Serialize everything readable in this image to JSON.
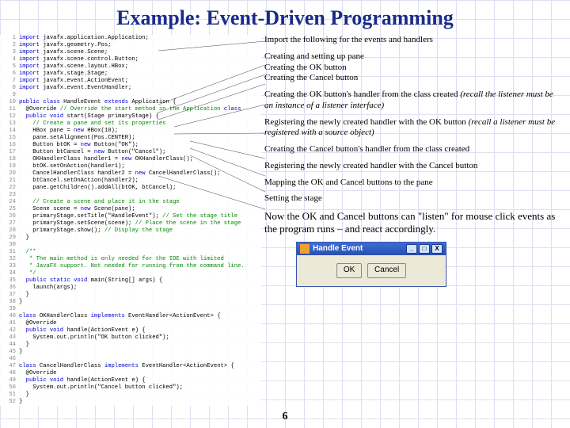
{
  "title": "Example: Event-Driven Programming",
  "code": [
    "import javafx.application.Application;",
    "import javafx.geometry.Pos;",
    "import javafx.scene.Scene;",
    "import javafx.scene.control.Button;",
    "import javafx.scene.layout.HBox;",
    "import javafx.stage.Stage;",
    "import javafx.event.ActionEvent;",
    "import javafx.event.EventHandler;",
    "",
    "public class HandleEvent extends Application {",
    "  @Override // Override the start method in the Application class",
    "  public void start(Stage primaryStage) {",
    "    // Create a pane and set its properties",
    "    HBox pane = new HBox(10);",
    "    pane.setAlignment(Pos.CENTER);",
    "    Button btOK = new Button(\"OK\");",
    "    Button btCancel = new Button(\"Cancel\");",
    "    OKHandlerClass handler1 = new OKHandlerClass();",
    "    btOK.setOnAction(handler1);",
    "    CancelHandlerClass handler2 = new CancelHandlerClass();",
    "    btCancel.setOnAction(handler2);",
    "    pane.getChildren().addAll(btOK, btCancel);",
    "",
    "    // Create a scene and place it in the stage",
    "    Scene scene = new Scene(pane);",
    "    primaryStage.setTitle(\"HandleEvent\"); // Set the stage title",
    "    primaryStage.setScene(scene); // Place the scene in the stage",
    "    primaryStage.show(); // Display the stage",
    "  }",
    "",
    "  /**",
    "   * The main method is only needed for the IDE with limited",
    "   * JavaFX support. Not needed for running from the command line.",
    "   */",
    "  public static void main(String[] args) {",
    "    launch(args);",
    "  }",
    "}",
    "",
    "class OKHandlerClass implements EventHandler<ActionEvent> {",
    "  @Override",
    "  public void handle(ActionEvent e) {",
    "    System.out.println(\"OK button clicked\");",
    "  }",
    "}",
    "",
    "class CancelHandlerClass implements EventHandler<ActionEvent> {",
    "  @Override",
    "  public void handle(ActionEvent e) {",
    "    System.out.println(\"Cancel button clicked\");",
    "  }",
    "}"
  ],
  "ann": {
    "a1": "Import the following for the events and handlers",
    "a2a": "Creating and setting up pane",
    "a2b": "Creating the OK button",
    "a2c": "Creating the Cancel button",
    "a3": "Creating the OK button's handler from the class created ",
    "a3i": "(recall the listener must be an instance of a listener interface)",
    "a4": "Registering the newly created handler with the OK button ",
    "a4i": "(recall a listener must be registered with a source object)",
    "a5": "Creating the Cancel button's handler from the class created",
    "a6": "Registering the newly created handler with the Cancel button",
    "a7": "Mapping the OK and Cancel buttons to the pane",
    "a8": "Setting the stage"
  },
  "summary": "Now the OK and Cancel buttons can \"listen\" for mouse click events as the program runs – and react accordingly.",
  "window": {
    "title": "Handle Event",
    "btn_min": "_",
    "btn_max": "□",
    "btn_close": "X",
    "ok": "OK",
    "cancel": "Cancel"
  },
  "page": "6"
}
